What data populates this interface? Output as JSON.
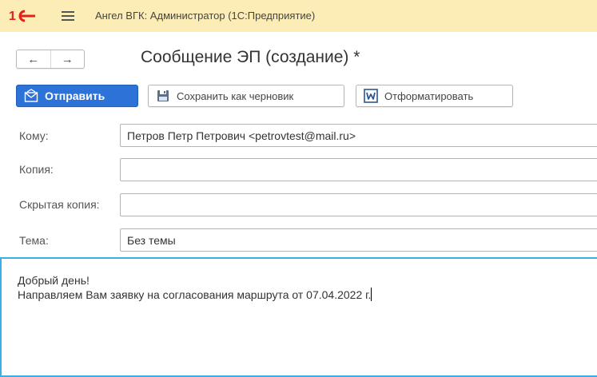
{
  "window": {
    "app_title": "Ангел ВГК: Администратор  (1С:Предприятие)"
  },
  "header": {
    "back_label": "←",
    "forward_label": "→",
    "page_title": "Сообщение ЭП (создание) *"
  },
  "toolbar": {
    "send_label": "Отправить",
    "save_draft_label": "Сохранить как черновик",
    "format_label": "Отформатировать"
  },
  "form": {
    "to": {
      "label": "Кому:",
      "value": "Петров Петр Петрович <petrovtest@mail.ru>"
    },
    "cc": {
      "label": "Копия:",
      "value": ""
    },
    "bcc": {
      "label": "Скрытая копия:",
      "value": ""
    },
    "subject": {
      "label": "Тема:",
      "value": "Без темы"
    }
  },
  "body": {
    "lines": [
      "Добрый день!",
      "Направляем Вам заявку на согласования маршрута от 07.04.2022 г."
    ]
  },
  "icons": {
    "logo": "1c-logo-icon",
    "menu": "hamburger-menu-icon",
    "send": "envelope-send-icon",
    "save": "floppy-disk-icon",
    "format": "word-icon"
  },
  "colors": {
    "titlebar_bg": "#fbedb5",
    "accent_blue": "#2d72d6",
    "editor_border": "#3aaee5",
    "logo_red": "#e2231a"
  }
}
